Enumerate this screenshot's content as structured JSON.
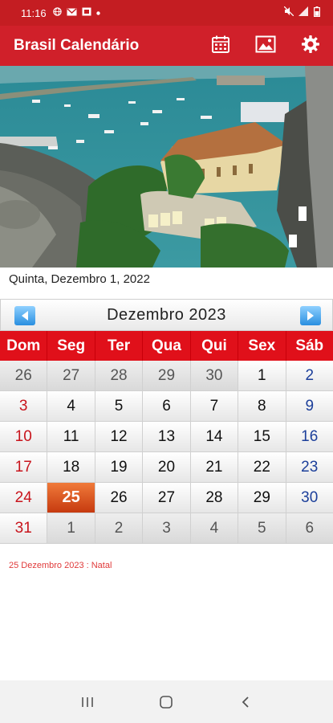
{
  "status": {
    "time": "11:16",
    "left_icons": [
      "globe-icon",
      "mail-icon",
      "photo-icon",
      "dot-icon"
    ],
    "right_icons": [
      "mute-icon",
      "signal-icon",
      "battery-icon"
    ]
  },
  "app": {
    "title": "Brasil Calendário",
    "actions": [
      "calendar-icon",
      "image-icon",
      "settings-icon"
    ],
    "accent": "#d0202a"
  },
  "current_date": "Quinta, Dezembro 1, 2022",
  "calendar": {
    "month_title": "Dezembro  2023",
    "weekdays": [
      "Dom",
      "Seg",
      "Ter",
      "Qua",
      "Qui",
      "Sex",
      "Sáb"
    ],
    "weeks": [
      [
        {
          "d": "26",
          "t": "other"
        },
        {
          "d": "27",
          "t": "other"
        },
        {
          "d": "28",
          "t": "other"
        },
        {
          "d": "29",
          "t": "other"
        },
        {
          "d": "30",
          "t": "other"
        },
        {
          "d": "1",
          "t": ""
        },
        {
          "d": "2",
          "t": "sat"
        }
      ],
      [
        {
          "d": "3",
          "t": "sun"
        },
        {
          "d": "4",
          "t": ""
        },
        {
          "d": "5",
          "t": ""
        },
        {
          "d": "6",
          "t": ""
        },
        {
          "d": "7",
          "t": ""
        },
        {
          "d": "8",
          "t": ""
        },
        {
          "d": "9",
          "t": "sat"
        }
      ],
      [
        {
          "d": "10",
          "t": "sun"
        },
        {
          "d": "11",
          "t": ""
        },
        {
          "d": "12",
          "t": ""
        },
        {
          "d": "13",
          "t": ""
        },
        {
          "d": "14",
          "t": ""
        },
        {
          "d": "15",
          "t": ""
        },
        {
          "d": "16",
          "t": "sat"
        }
      ],
      [
        {
          "d": "17",
          "t": "sun"
        },
        {
          "d": "18",
          "t": ""
        },
        {
          "d": "19",
          "t": ""
        },
        {
          "d": "20",
          "t": ""
        },
        {
          "d": "21",
          "t": ""
        },
        {
          "d": "22",
          "t": ""
        },
        {
          "d": "23",
          "t": "sat"
        }
      ],
      [
        {
          "d": "24",
          "t": "sun"
        },
        {
          "d": "25",
          "t": "today"
        },
        {
          "d": "26",
          "t": ""
        },
        {
          "d": "27",
          "t": ""
        },
        {
          "d": "28",
          "t": ""
        },
        {
          "d": "29",
          "t": ""
        },
        {
          "d": "30",
          "t": "sat"
        }
      ],
      [
        {
          "d": "31",
          "t": "sun"
        },
        {
          "d": "1",
          "t": "other"
        },
        {
          "d": "2",
          "t": "other"
        },
        {
          "d": "3",
          "t": "other"
        },
        {
          "d": "4",
          "t": "other"
        },
        {
          "d": "5",
          "t": "other"
        },
        {
          "d": "6",
          "t": "other"
        }
      ]
    ]
  },
  "holiday_note": "25 Dezembro 2023 : Natal",
  "nav": [
    "recents-icon",
    "home-icon",
    "back-icon"
  ]
}
